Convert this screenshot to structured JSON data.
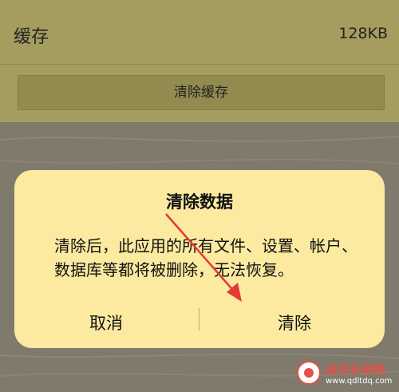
{
  "cache": {
    "label": "缓存",
    "size": "128KB",
    "clear_button_label": "清除缓存"
  },
  "dialog": {
    "title": "清除数据",
    "message": "清除后，此应用的所有文件、设置、帐户、数据库等都将被删除，无法恢复。",
    "cancel_label": "取消",
    "confirm_label": "清除"
  },
  "watermark": {
    "brand": "启东安卓网",
    "url": "www.qdltdq.com"
  },
  "colors": {
    "dialog_bg": "#fbeaa0",
    "overlay": "#7d786c",
    "arrow": "#e53935"
  }
}
